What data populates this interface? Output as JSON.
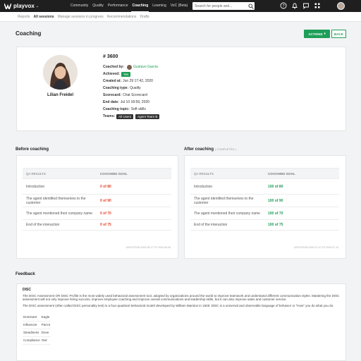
{
  "app": {
    "brand": "playvox",
    "nav": [
      "Community",
      "Quality",
      "Performance",
      "Coaching",
      "Learning",
      "VoC (Beta)"
    ],
    "active_nav": "Coaching",
    "search_placeholder": "Search for people and...",
    "accent": "#1e9e58"
  },
  "subnav": [
    "Reports",
    "All sessions",
    "Manage sessions in progress",
    "Recommendations",
    "Drafts"
  ],
  "page": {
    "title": "Coaching",
    "actions_label": "ACTIONS",
    "back_label": "BACK"
  },
  "profile": {
    "name": "Lilian Freidel",
    "id": "# 3600",
    "coached_by_label": "Coached by:",
    "coached_by": "Gustavo Garcia",
    "achieved_label": "Achieved:",
    "achieved": "Yes",
    "created_label": "Created at:",
    "created": "Jun 29 17:42, 2020",
    "type_label": "Coaching type:",
    "type": "Quality",
    "scorecard_label": "Scorecard:",
    "scorecard": "Chat Scorecard",
    "end_label": "End date:",
    "end": "Jul 10 18:59, 2020",
    "topic_label": "Coaching topic:",
    "topic": "Soft skills",
    "teams_label": "Teams:",
    "teams": [
      "All Users",
      "Agent Team B"
    ]
  },
  "before": {
    "title": "Before coaching",
    "col1": "QA RESULTS",
    "col2": "COACHING GOAL",
    "rows": [
      {
        "label": "Introduction",
        "score": "0 of 80",
        "fill": 0
      },
      {
        "label": "The agent identified themselves to the customer",
        "score": "0 of 90",
        "fill": 0
      },
      {
        "label": "The agent mentioned their company name",
        "score": "0 of 70",
        "fill": 0
      },
      {
        "label": "End of the interaction",
        "score": "0 of 75",
        "fill": 0
      }
    ],
    "footer": "DATA FROM 2020-06-27 TO 2020-06-28"
  },
  "after": {
    "title": "After coaching",
    "status": "( COMPLETED )",
    "col1": "QA RESULTS",
    "col2": "COACHING GOAL",
    "rows": [
      {
        "label": "Introduction",
        "score": "100 of 80",
        "fill": 100,
        "bar_label": "100"
      },
      {
        "label": "The agent identified themselves to the customer",
        "score": "100 of 90",
        "fill": 100,
        "bar_label": "100"
      },
      {
        "label": "The agent mentioned their company name",
        "score": "100 of 70",
        "fill": 100,
        "bar_label": "100"
      },
      {
        "label": "End of the interaction",
        "score": "100 of 75",
        "fill": 100,
        "bar_label": "100"
      }
    ],
    "footer": "DATA FROM 2020-07-10 TO 2020-07-10"
  },
  "feedback": {
    "title": "Feedback",
    "heading": "DISC",
    "para1": "The DISC Assessment OR DISC Profile is the most widely used behavioral assessment tool, adopted by organizations around the world to improve teamwork and understand different communication styles.   Mastering the DISC assessment will not only improve hiring success, improve employee coaching and improve overall communications and leadership skills, but it can also improve sales and customer service.",
    "para2": "The DISC assessment (often called DISC personality test) is a four-quadrant behavioral model developed by William Marston in 1928. DISC is a universal and observable language of behavior or \"How\" you do what you do.",
    "disc": [
      {
        "k": "Dominant",
        "v": "Eagle"
      },
      {
        "k": "Influencer",
        "v": "Parrot"
      },
      {
        "k": "Steadiness",
        "v": "Dove"
      },
      {
        "k": "Compliance",
        "v": "Owl"
      }
    ]
  }
}
